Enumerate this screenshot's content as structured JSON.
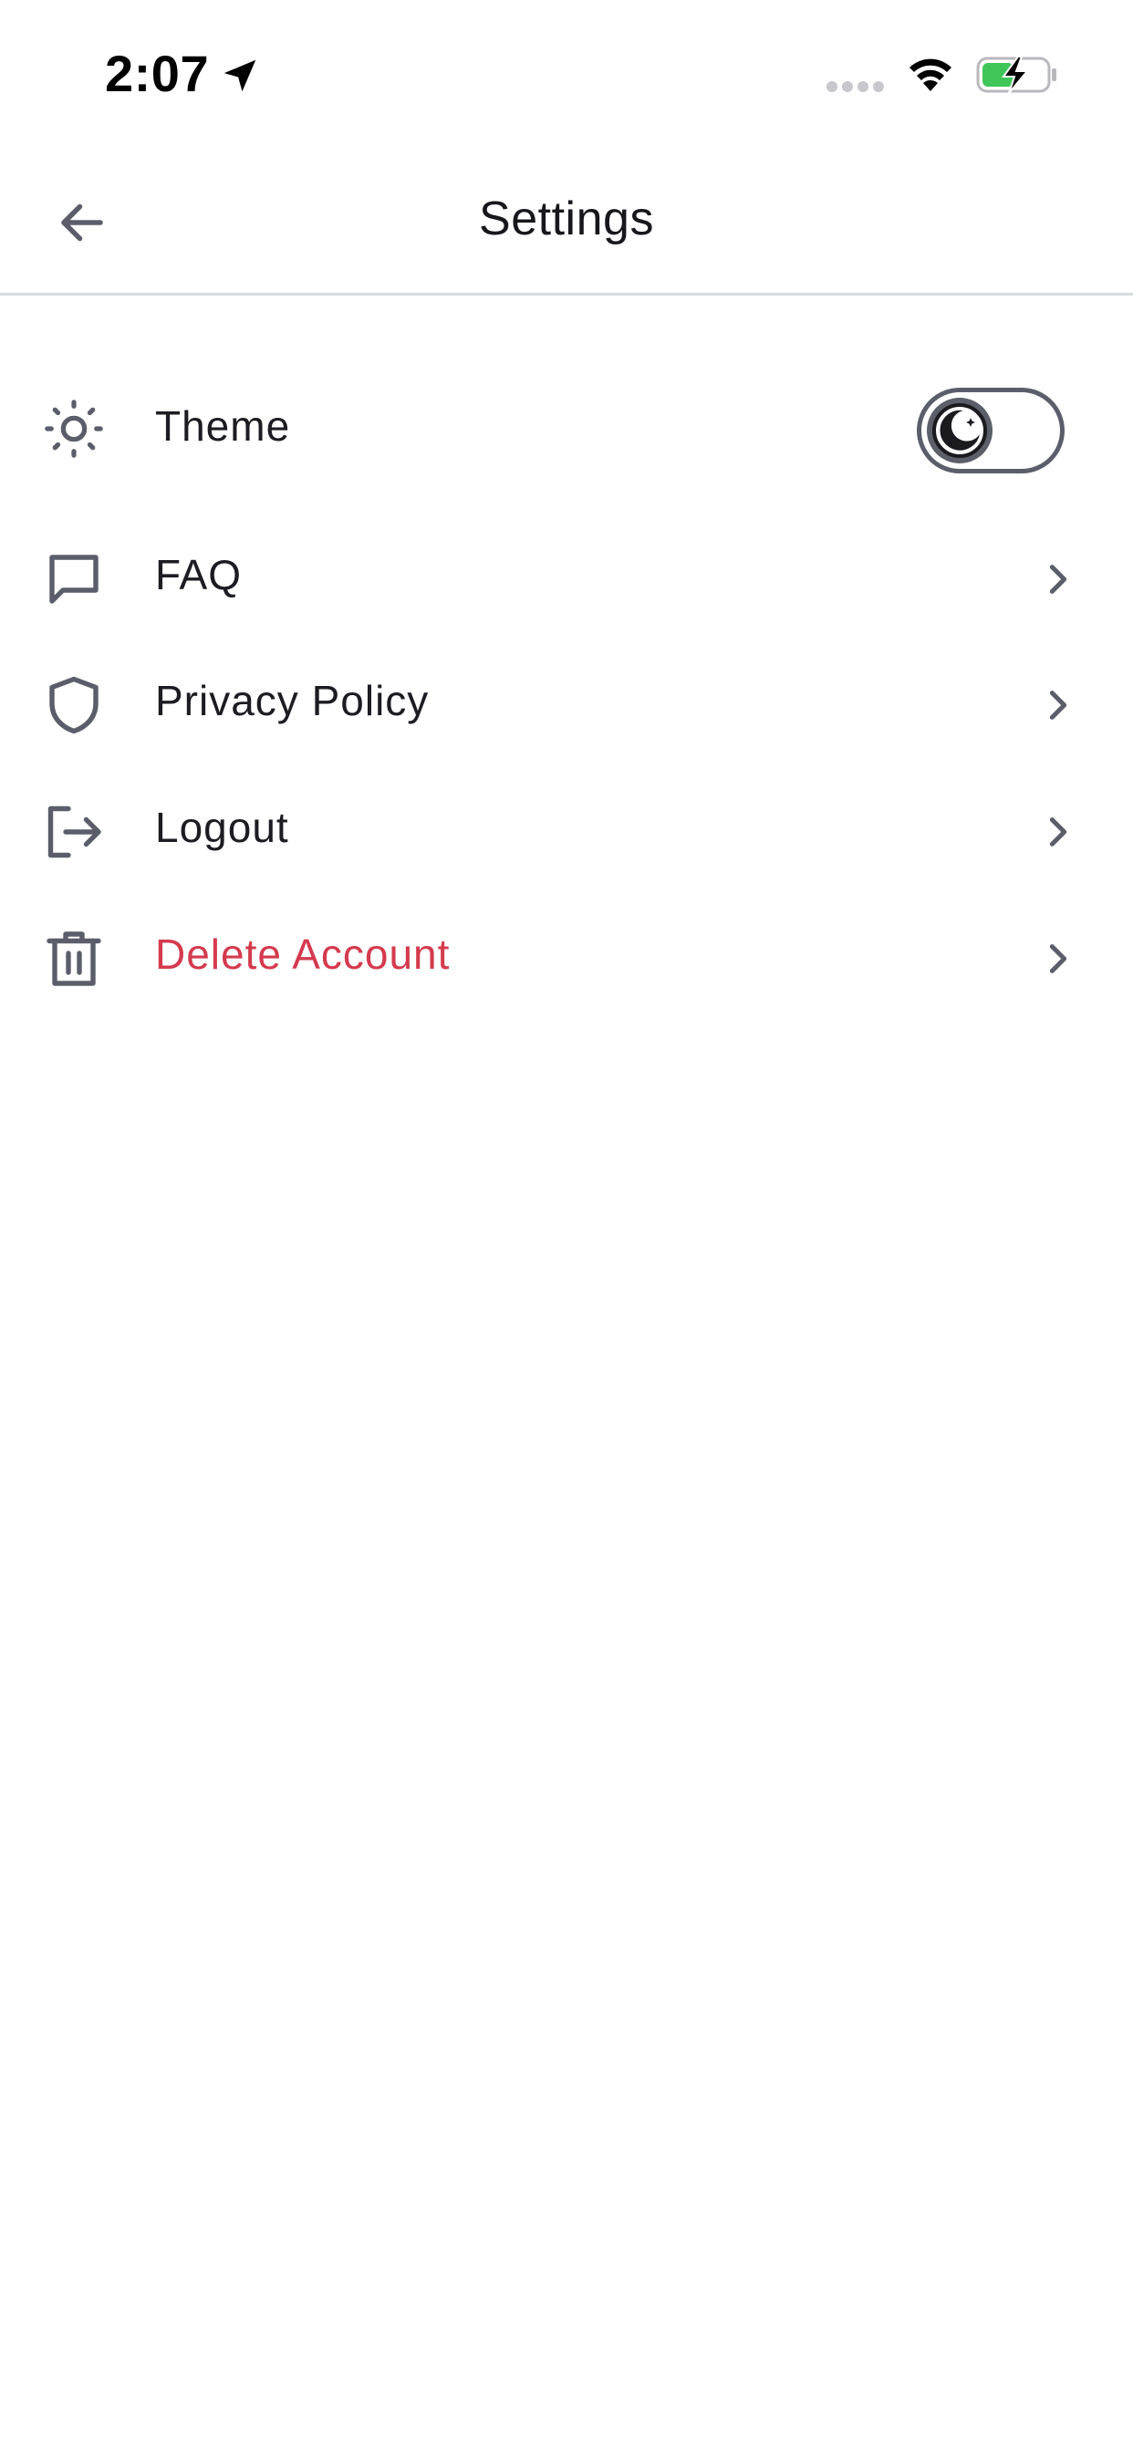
{
  "status_bar": {
    "time": "2:07",
    "icons": [
      "location-arrow-icon",
      "signal-icon",
      "wifi-icon",
      "battery-charging-icon"
    ],
    "battery_color": "#3fc55a"
  },
  "header": {
    "title": "Settings",
    "back_icon": "arrow-left-icon"
  },
  "settings": {
    "items": [
      {
        "label": "Theme",
        "icon": "sun-icon",
        "control": "toggle",
        "toggle_icon": "moon-icon"
      },
      {
        "label": "FAQ",
        "icon": "chat-bubble-icon",
        "control": "chevron"
      },
      {
        "label": "Privacy Policy",
        "icon": "shield-icon",
        "control": "chevron"
      },
      {
        "label": "Logout",
        "icon": "logout-icon",
        "control": "chevron"
      },
      {
        "label": "Delete Account",
        "icon": "trash-icon",
        "control": "chevron",
        "color": "#d43a4e"
      }
    ]
  },
  "colors": {
    "icon": "#5b5e6a",
    "text": "#1c1c22",
    "danger": "#d43a4e",
    "divider": "#d3dcdc"
  }
}
